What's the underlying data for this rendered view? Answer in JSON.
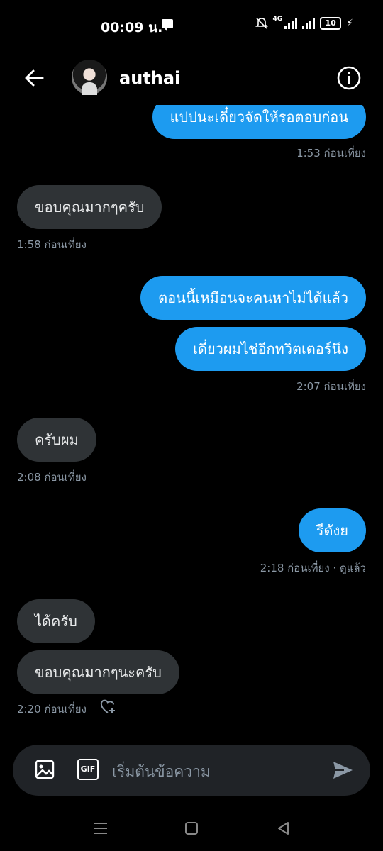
{
  "status_bar": {
    "time": "00:09 น.",
    "network": "4G",
    "battery": "10"
  },
  "header": {
    "name": "authai"
  },
  "messages": [
    {
      "dir": "out",
      "text": "แปปนะเดี๋ยวจัดให้รอตอบก่อน"
    },
    {
      "dir": "meta-out",
      "text": "1:53 ก่อนเที่ยง"
    },
    {
      "dir": "in",
      "text": "ขอบคุณมากๆครับ"
    },
    {
      "dir": "meta-in",
      "text": "1:58 ก่อนเที่ยง"
    },
    {
      "dir": "out",
      "text": "ตอนนี้เหมือนจะคนหาไม่ได้แล้ว"
    },
    {
      "dir": "out",
      "text": "เดี่ยวผมไช่อีกทวิตเตอร์นึง"
    },
    {
      "dir": "meta-out",
      "text": "2:07 ก่อนเที่ยง"
    },
    {
      "dir": "in",
      "text": "ครับผม"
    },
    {
      "dir": "meta-in",
      "text": "2:08 ก่อนเที่ยง"
    },
    {
      "dir": "out",
      "text": "รีดังย"
    },
    {
      "dir": "meta-out",
      "text": "2:18 ก่อนเที่ยง · ดูแล้ว"
    },
    {
      "dir": "in",
      "text": "ได้ครับ"
    },
    {
      "dir": "in",
      "text": "ขอบคุณมากๆนะครับ"
    },
    {
      "dir": "meta-in",
      "text": "2:20 ก่อนเที่ยง"
    }
  ],
  "composer": {
    "placeholder": "เริ่มต้นข้อความ",
    "gif_label": "GIF"
  },
  "colors": {
    "accent": "#1d9bf0",
    "incoming": "#2f3336",
    "background": "#000000",
    "muted": "#8b98a5"
  }
}
